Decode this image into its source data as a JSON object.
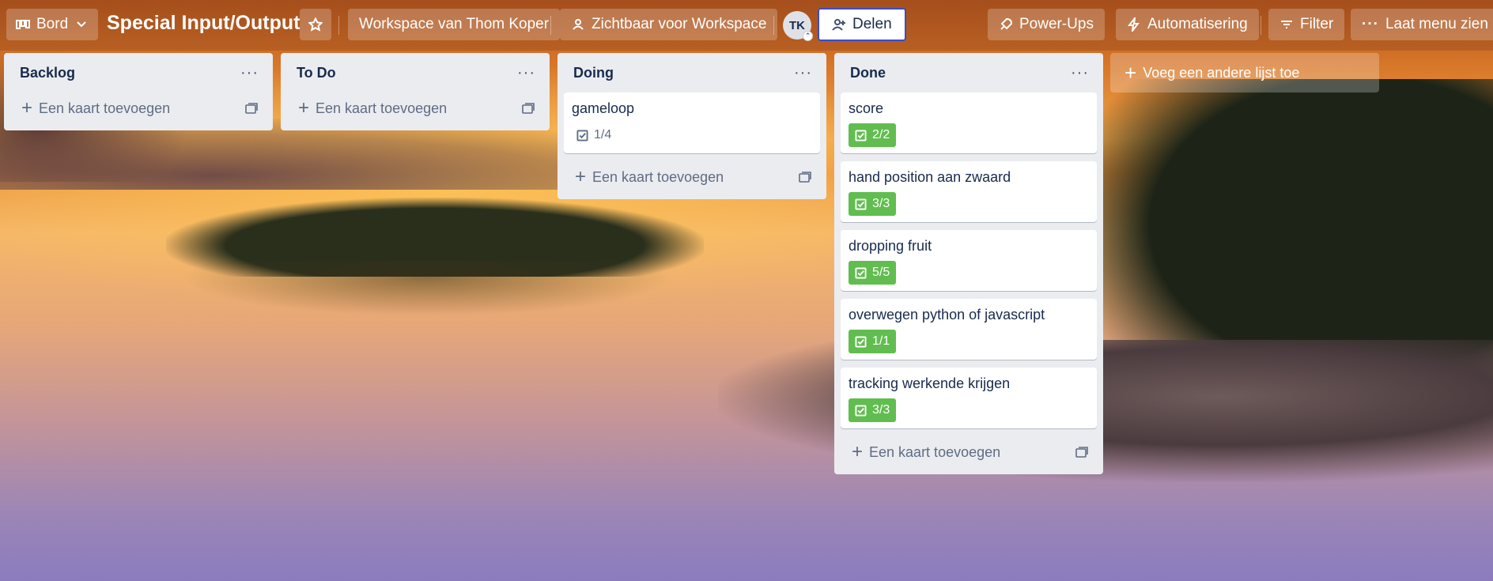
{
  "header": {
    "view_switcher_label": "Bord",
    "board_title": "Special Input/Output",
    "workspace_label": "Workspace van Thom Koper",
    "visibility_label": "Zichtbaar voor Workspace",
    "avatar_initials": "TK",
    "share_label": "Delen",
    "powerups_label": "Power-Ups",
    "automation_label": "Automatisering",
    "filter_label": "Filter",
    "menu_label": "Laat menu zien"
  },
  "lists": [
    {
      "title": "Backlog",
      "add_card_label": "Een kaart toevoegen",
      "cards": []
    },
    {
      "title": "To Do",
      "add_card_label": "Een kaart toevoegen",
      "cards": []
    },
    {
      "title": "Doing",
      "add_card_label": "Een kaart toevoegen",
      "cards": [
        {
          "title": "gameloop",
          "checklist": "1/4",
          "complete": false
        }
      ]
    },
    {
      "title": "Done",
      "add_card_label": "Een kaart toevoegen",
      "cards": [
        {
          "title": "score",
          "checklist": "2/2",
          "complete": true
        },
        {
          "title": "hand position aan zwaard",
          "checklist": "3/3",
          "complete": true
        },
        {
          "title": "dropping fruit",
          "checklist": "5/5",
          "complete": true
        },
        {
          "title": "overwegen python of javascript",
          "checklist": "1/1",
          "complete": true
        },
        {
          "title": "tracking werkende krijgen",
          "checklist": "3/3",
          "complete": true
        }
      ]
    }
  ],
  "add_list_label": "Voeg een andere lijst toe",
  "colors": {
    "checklist_complete": "#61bd4f",
    "list_background": "#ebecf0",
    "share_border": "#3b4bc8"
  }
}
